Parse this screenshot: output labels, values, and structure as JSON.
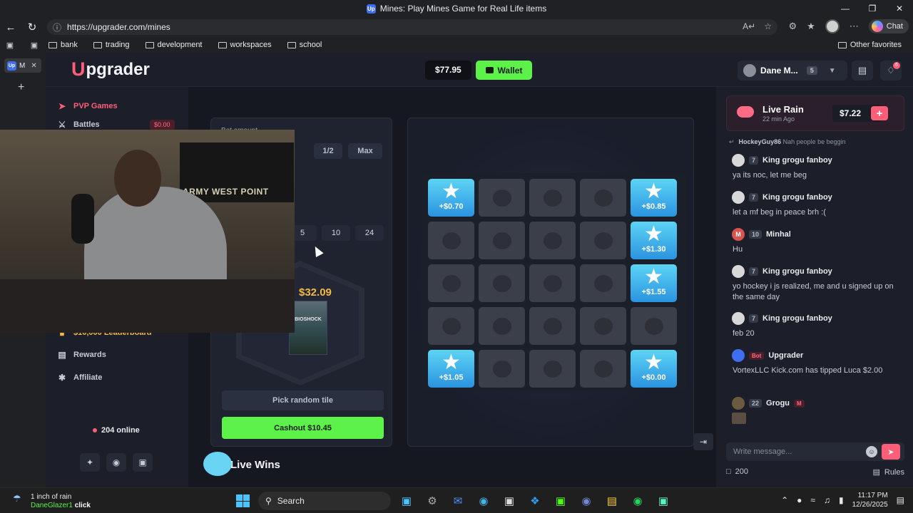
{
  "browser": {
    "title": "Mines: Play Mines Game for Real Life items",
    "url": "https://upgrader.com/mines",
    "chat_label": "Chat",
    "bookmarks": [
      "bank",
      "trading",
      "development",
      "workspaces",
      "school"
    ],
    "other_favorites": "Other favorites",
    "vertical_tab_label": "M"
  },
  "header": {
    "brand_letter": "U",
    "brand_rest": "pgrader",
    "balance": "$77.95",
    "wallet_label": "Wallet",
    "user_name": "Dane M...",
    "user_level": "5",
    "notif_count": "6"
  },
  "sidebar": {
    "pvp_label": "PVP Games",
    "battles_label": "Battles",
    "battles_badge": "$0.00",
    "leaderboard_label": "$10,000 Leaderboard",
    "rewards_label": "Rewards",
    "affiliate_label": "Affiliate",
    "online_text": "204 online"
  },
  "controls": {
    "bet_label": "Bet amount",
    "half_label": "1/2",
    "max_label": "Max",
    "mine_options": [
      "5",
      "10",
      "24"
    ],
    "prize_price": "$32.09",
    "prize_item_label": "BIOSHOCK",
    "pick_random_label": "Pick random tile",
    "cashout_label": "Cashout $10.45"
  },
  "board": {
    "tiles": [
      {
        "type": "star",
        "amount": "+$0.70"
      },
      {
        "type": "bomb"
      },
      {
        "type": "bomb"
      },
      {
        "type": "bomb"
      },
      {
        "type": "star",
        "amount": "+$0.85"
      },
      {
        "type": "bomb"
      },
      {
        "type": "bomb"
      },
      {
        "type": "bomb"
      },
      {
        "type": "bomb"
      },
      {
        "type": "star",
        "amount": "+$1.30"
      },
      {
        "type": "bomb"
      },
      {
        "type": "bomb"
      },
      {
        "type": "bomb"
      },
      {
        "type": "bomb"
      },
      {
        "type": "star",
        "amount": "+$1.55"
      },
      {
        "type": "bomb"
      },
      {
        "type": "bomb"
      },
      {
        "type": "bomb"
      },
      {
        "type": "bomb"
      },
      {
        "type": "bomb"
      },
      {
        "type": "star",
        "amount": "+$1.05"
      },
      {
        "type": "bomb"
      },
      {
        "type": "bomb"
      },
      {
        "type": "bomb"
      },
      {
        "type": "star",
        "amount": "+$0.00"
      }
    ]
  },
  "live_wins_label": "Live Wins",
  "webcam": {
    "flag_text": "ARMY WEST POINT"
  },
  "chat": {
    "rain_title": "Live Rain",
    "rain_ago": "22 min Ago",
    "rain_amount": "$7.22",
    "reply_user": "HockeyGuy86",
    "reply_text": "Nah people be beggin",
    "messages": [
      {
        "level": "7",
        "user": "King grogu fanboy",
        "text": "ya its noc, let me beg"
      },
      {
        "level": "7",
        "user": "King grogu fanboy",
        "text": "let a mf beg in peace brh :("
      },
      {
        "level": "10",
        "user": "Minhal",
        "text": "Hu",
        "avatar_letter": "M"
      },
      {
        "level": "7",
        "user": "King grogu fanboy",
        "text": "yo hockey i js realized, me and u signed up on the same day"
      },
      {
        "level": "7",
        "user": "King grogu fanboy",
        "text": "feb 20"
      },
      {
        "bot_tag": "Bot",
        "user": "Upgrader",
        "text": "VortexLLC Kick.com has tipped Luca $2.00"
      },
      {
        "level": "22",
        "user": "Grogu",
        "tag": "M",
        "text": ""
      }
    ],
    "input_placeholder": "Write message...",
    "online_count": "200",
    "rules_label": "Rules"
  },
  "taskbar": {
    "weather_line1": "1 inch of rain",
    "weather_user": "DaneGlazer1",
    "weather_action": "click",
    "search_label": "Search",
    "time": "11:17 PM",
    "date": "12/26/2025"
  },
  "colors": {
    "accent_pink": "#ff5e79",
    "accent_green": "#5cf24a",
    "star_blue": "#2b93e0"
  }
}
